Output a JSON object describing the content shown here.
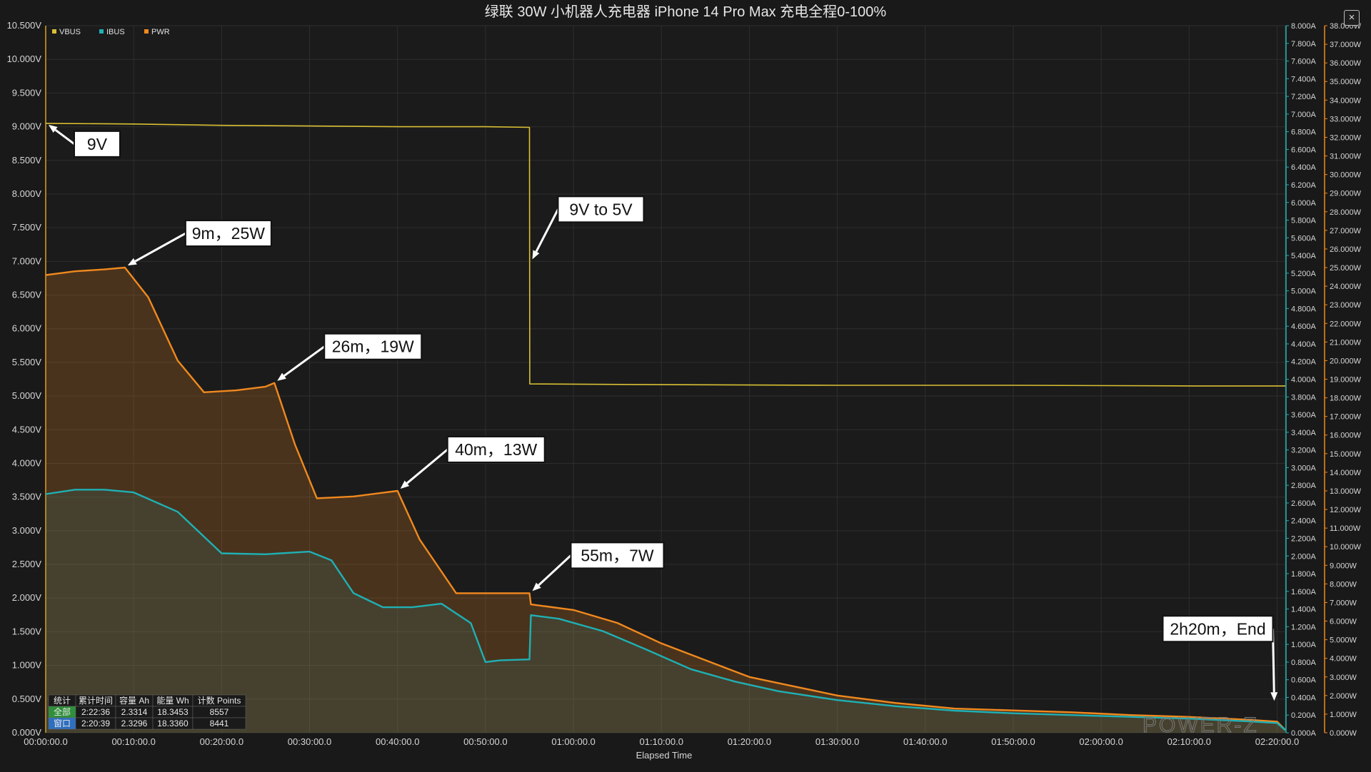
{
  "window": {
    "close_glyph": "×",
    "close_icon": "close-icon"
  },
  "colors": {
    "background": "#191919",
    "plot_bg": "#1b1b1b",
    "grid": "#2e2e2e",
    "vbus": "#d9c033",
    "ibus": "#1fb0b5",
    "pwr": "#f0891e"
  },
  "chart_data": {
    "type": "line",
    "title": "绿联 30W 小机器人充电器 iPhone 14 Pro Max 充电全程0-100%",
    "xlabel": "Elapsed Time",
    "x_unit": "seconds",
    "xlim": [
      0,
      8456
    ],
    "x_ticks": [
      0,
      600,
      1200,
      1800,
      2400,
      3000,
      3600,
      4200,
      4800,
      5400,
      6000,
      6600,
      7200,
      7800,
      8400
    ],
    "x_tick_labels": [
      "00:00:00.0",
      "00:10:00.0",
      "00:20:00.0",
      "00:30:00.0",
      "00:40:00.0",
      "00:50:00.0",
      "01:00:00.0",
      "01:10:00.0",
      "01:20:00.0",
      "01:30:00.0",
      "01:40:00.0",
      "01:50:00.0",
      "02:00:00.0",
      "02:10:00.0",
      "02:20:00.0"
    ],
    "axes": {
      "voltage": {
        "unit": "V",
        "ylim": [
          0,
          10.5
        ],
        "ticks": [
          0,
          0.5,
          1,
          1.5,
          2,
          2.5,
          3,
          3.5,
          4,
          4.5,
          5,
          5.5,
          6,
          6.5,
          7,
          7.5,
          8,
          8.5,
          9,
          9.5,
          10,
          10.5
        ],
        "tick_labels": [
          "0.000V",
          "0.500V",
          "1.000V",
          "1.500V",
          "2.000V",
          "2.500V",
          "3.000V",
          "3.500V",
          "4.000V",
          "4.500V",
          "5.000V",
          "5.500V",
          "6.000V",
          "6.500V",
          "7.000V",
          "7.500V",
          "8.000V",
          "8.500V",
          "9.000V",
          "9.500V",
          "10.000V",
          "10.500V"
        ]
      },
      "current": {
        "unit": "A",
        "ylim": [
          0,
          8.0
        ],
        "tick_labels": [
          "0.000A",
          "0.200A",
          "0.400A",
          "0.600A",
          "0.800A",
          "1.000A",
          "1.200A",
          "1.400A",
          "1.600A",
          "1.800A",
          "2.000A",
          "2.200A",
          "2.400A",
          "2.600A",
          "2.800A",
          "3.000A",
          "3.200A",
          "3.400A",
          "3.600A",
          "3.800A",
          "4.000A",
          "4.200A",
          "4.400A",
          "4.600A",
          "4.800A",
          "5.000A",
          "5.200A",
          "5.400A",
          "5.600A",
          "5.800A",
          "6.000A",
          "6.200A",
          "6.400A",
          "6.600A",
          "6.800A",
          "7.000A",
          "7.200A",
          "7.400A",
          "7.600A",
          "7.800A",
          "8.000A"
        ]
      },
      "power": {
        "unit": "W",
        "ylim": [
          0,
          38.0
        ],
        "tick_labels": [
          "0.000W",
          "1.000W",
          "2.000W",
          "3.000W",
          "4.000W",
          "5.000W",
          "6.000W",
          "7.000W",
          "8.000W",
          "9.000W",
          "10.000W",
          "11.000W",
          "12.000W",
          "13.000W",
          "14.000W",
          "15.000W",
          "16.000W",
          "17.000W",
          "18.000W",
          "19.000W",
          "20.000W",
          "21.000W",
          "22.000W",
          "23.000W",
          "24.000W",
          "25.000W",
          "26.000W",
          "27.000W",
          "28.000W",
          "29.000W",
          "30.000W",
          "31.000W",
          "32.000W",
          "33.000W",
          "34.000W",
          "35.000W",
          "36.000W",
          "37.000W",
          "38.000W"
        ]
      }
    },
    "grid": true,
    "legend": {
      "placement": "top-left",
      "entries": [
        "VBUS",
        "IBUS",
        "PWR"
      ]
    },
    "series": [
      {
        "name": "VBUS",
        "axis": "voltage",
        "color": "#d9c033",
        "points": [
          [
            0,
            9.05
          ],
          [
            600,
            9.04
          ],
          [
            1200,
            9.02
          ],
          [
            1800,
            9.01
          ],
          [
            2400,
            9.0
          ],
          [
            3000,
            9.0
          ],
          [
            3300,
            8.99
          ],
          [
            3302,
            5.18
          ],
          [
            4200,
            5.17
          ],
          [
            5400,
            5.16
          ],
          [
            6600,
            5.16
          ],
          [
            7800,
            5.15
          ],
          [
            8456,
            5.15
          ]
        ]
      },
      {
        "name": "IBUS",
        "axis": "current",
        "color": "#1fb0b5",
        "points": [
          [
            0,
            2.7
          ],
          [
            200,
            2.75
          ],
          [
            400,
            2.75
          ],
          [
            600,
            2.72
          ],
          [
            900,
            2.5
          ],
          [
            1200,
            2.03
          ],
          [
            1500,
            2.02
          ],
          [
            1800,
            2.05
          ],
          [
            1950,
            1.95
          ],
          [
            2100,
            1.58
          ],
          [
            2300,
            1.42
          ],
          [
            2500,
            1.42
          ],
          [
            2700,
            1.46
          ],
          [
            2900,
            1.24
          ],
          [
            3000,
            0.8
          ],
          [
            3100,
            0.82
          ],
          [
            3300,
            0.83
          ],
          [
            3310,
            1.33
          ],
          [
            3500,
            1.29
          ],
          [
            3800,
            1.15
          ],
          [
            4100,
            0.94
          ],
          [
            4400,
            0.72
          ],
          [
            4700,
            0.58
          ],
          [
            5000,
            0.47
          ],
          [
            5400,
            0.37
          ],
          [
            5800,
            0.3
          ],
          [
            6200,
            0.25
          ],
          [
            6600,
            0.22
          ],
          [
            7000,
            0.2
          ],
          [
            7400,
            0.18
          ],
          [
            7800,
            0.16
          ],
          [
            8200,
            0.13
          ],
          [
            8400,
            0.11
          ],
          [
            8456,
            0.03
          ]
        ]
      },
      {
        "name": "PWR",
        "axis": "power",
        "color": "#f0891e",
        "points": [
          [
            0,
            24.6
          ],
          [
            200,
            24.8
          ],
          [
            400,
            24.9
          ],
          [
            540,
            25.0
          ],
          [
            700,
            23.4
          ],
          [
            900,
            20.0
          ],
          [
            1080,
            18.3
          ],
          [
            1300,
            18.4
          ],
          [
            1500,
            18.6
          ],
          [
            1560,
            18.8
          ],
          [
            1700,
            15.5
          ],
          [
            1850,
            12.6
          ],
          [
            2100,
            12.7
          ],
          [
            2300,
            12.9
          ],
          [
            2400,
            13.0
          ],
          [
            2550,
            10.4
          ],
          [
            2800,
            7.5
          ],
          [
            3000,
            7.5
          ],
          [
            3300,
            7.5
          ],
          [
            3310,
            6.9
          ],
          [
            3600,
            6.6
          ],
          [
            3900,
            5.9
          ],
          [
            4200,
            4.8
          ],
          [
            4500,
            3.9
          ],
          [
            4800,
            3.0
          ],
          [
            5100,
            2.5
          ],
          [
            5400,
            2.0
          ],
          [
            5800,
            1.6
          ],
          [
            6200,
            1.3
          ],
          [
            6600,
            1.2
          ],
          [
            7000,
            1.1
          ],
          [
            7400,
            0.95
          ],
          [
            7800,
            0.85
          ],
          [
            8200,
            0.7
          ],
          [
            8400,
            0.6
          ],
          [
            8456,
            0.15
          ]
        ]
      }
    ],
    "annotations": [
      {
        "text": "9V",
        "x": 0,
        "y": 9.05,
        "axis": "voltage"
      },
      {
        "text": "9m，25W",
        "x": 540,
        "y": 25.0,
        "axis": "power"
      },
      {
        "text": "9V to 5V",
        "x": 3300,
        "y": 7.0,
        "axis": "voltage"
      },
      {
        "text": "26m，19W",
        "x": 1560,
        "y": 18.8,
        "axis": "power"
      },
      {
        "text": "40m，13W",
        "x": 2400,
        "y": 13.0,
        "axis": "power"
      },
      {
        "text": "55m，7W",
        "x": 3300,
        "y": 7.5,
        "axis": "power"
      },
      {
        "text": "2h20m，End",
        "x": 8400,
        "y": 1.6,
        "axis": "power"
      }
    ]
  },
  "stats_table": {
    "headers": [
      "统计",
      "累计时间",
      "容量 Ah",
      "能量 Wh",
      "计数 Points"
    ],
    "rows": [
      [
        "全部",
        "2:22:36",
        "2.3314",
        "18.3453",
        "8557"
      ],
      [
        "窗口",
        "2:20:39",
        "2.3296",
        "18.3360",
        "8441"
      ]
    ]
  },
  "watermark": "POWER-Z"
}
